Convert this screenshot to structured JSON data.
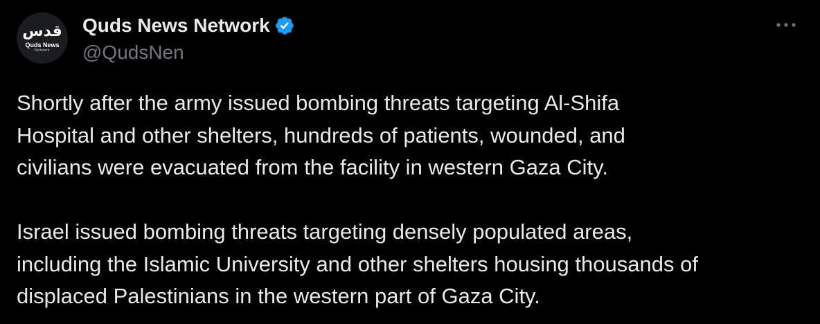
{
  "author": {
    "display_name": "Quds News Network",
    "handle": "@QudsNen",
    "verified": true,
    "avatar": {
      "mark": "قدس",
      "name": "Quds News",
      "sub": "Network",
      "bg_color": "#1a1c1f"
    }
  },
  "tweet": {
    "paragraphs": [
      "Shortly after the army issued bombing threats targeting Al-Shifa\nHospital and other shelters, hundreds of patients, wounded, and\ncivilians were evacuated from the facility in western Gaza City.",
      "Israel issued bombing threats targeting densely populated areas,\nincluding the Islamic University and other shelters housing thousands of\ndisplaced Palestinians in the western part of Gaza City."
    ]
  },
  "icons": {
    "verified": "verified-badge-icon",
    "more": "more-options-icon"
  },
  "colors": {
    "background": "#000000",
    "primary_text": "#e7e9ea",
    "secondary_text": "#71767b",
    "verified_blue": "#1d9bf0"
  }
}
